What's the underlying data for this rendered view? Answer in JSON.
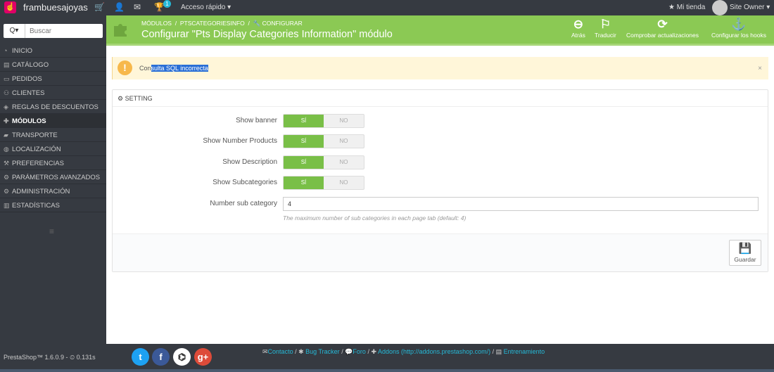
{
  "colors": {
    "accent": "#8bc954",
    "dark": "#363a41",
    "link": "#25b9d7",
    "warning": "#f7b84b",
    "toggle_on": "#79bf47"
  },
  "topbar": {
    "shop_name": "frambuesajoyas",
    "icons": [
      "cart-icon",
      "user-icon",
      "envelope-icon",
      "trophy-icon"
    ],
    "trophy_badge": "1",
    "quick_access": "Acceso rápido ▾",
    "my_shop": "Mi tienda",
    "owner": "Site Owner ▾"
  },
  "sidebar": {
    "search_type": "Q▾",
    "search_placeholder": "Buscar",
    "items": [
      {
        "label": "Inicio",
        "icon": "tachometer-icon"
      },
      {
        "label": "Catálogo",
        "icon": "book-icon"
      },
      {
        "label": "Pedidos",
        "icon": "credit-card-icon"
      },
      {
        "label": "Clientes",
        "icon": "users-icon"
      },
      {
        "label": "Reglas de descuentos",
        "icon": "tags-icon"
      },
      {
        "label": "Módulos",
        "icon": "puzzle-icon"
      },
      {
        "label": "Transporte",
        "icon": "truck-icon"
      },
      {
        "label": "Localización",
        "icon": "globe-icon"
      },
      {
        "label": "Preferencias",
        "icon": "wrench-icon"
      },
      {
        "label": "Parámetros avanzados",
        "icon": "cogs-icon"
      },
      {
        "label": "Administración",
        "icon": "cog-icon"
      },
      {
        "label": "Estadísticas",
        "icon": "bar-chart-icon"
      }
    ],
    "active_index": 5
  },
  "header": {
    "breadcrumb": [
      "MÓDULOS",
      "PTSCATEGORIESINFO",
      "CONFIGURAR"
    ],
    "breadcrumb_sep": "/",
    "title": "Configurar \"Pts Display Categories Information\" módulo",
    "toolbar": [
      {
        "label": "Atrás",
        "icon": "arrow-circle-left-icon"
      },
      {
        "label": "Traducir",
        "icon": "flag-icon"
      },
      {
        "label": "Comprobar actualizaciones",
        "icon": "refresh-icon"
      },
      {
        "label": "Configurar los hooks",
        "icon": "anchor-icon"
      }
    ]
  },
  "alert": {
    "prefix": "Con",
    "selected": "sulta SQL incorrecta",
    "close": "×"
  },
  "panel": {
    "heading": "Setting",
    "fields": [
      {
        "label": "Show banner",
        "yes": "SÍ",
        "no": "NO",
        "value": true
      },
      {
        "label": "Show Number Products",
        "yes": "SÍ",
        "no": "NO",
        "value": true
      },
      {
        "label": "Show Description",
        "yes": "SÍ",
        "no": "NO",
        "value": true
      },
      {
        "label": "Show Subcategories",
        "yes": "SÍ",
        "no": "NO",
        "value": true
      }
    ],
    "number_label": "Number sub category",
    "number_value": "4",
    "number_hint": "The maximum number of sub categories in each page tab (default: 4)",
    "save_label": "Guardar"
  },
  "footer": {
    "version": "PrestaShop™ 1.6.0.9 - ",
    "time": "0.131s",
    "social": [
      "twitter-icon",
      "facebook-icon",
      "github-icon",
      "google-plus-icon"
    ],
    "links": [
      {
        "label": "Contacto",
        "icon": "envelope-icon"
      },
      {
        "label": "Bug Tracker",
        "icon": "bug-icon"
      },
      {
        "label": "Foro",
        "icon": "comments-icon"
      },
      {
        "label": "Addons (http://addons.prestashop.com/)",
        "icon": "puzzle-icon"
      },
      {
        "label": "Entrenamiento",
        "icon": "book-icon"
      }
    ],
    "sep": " / "
  }
}
